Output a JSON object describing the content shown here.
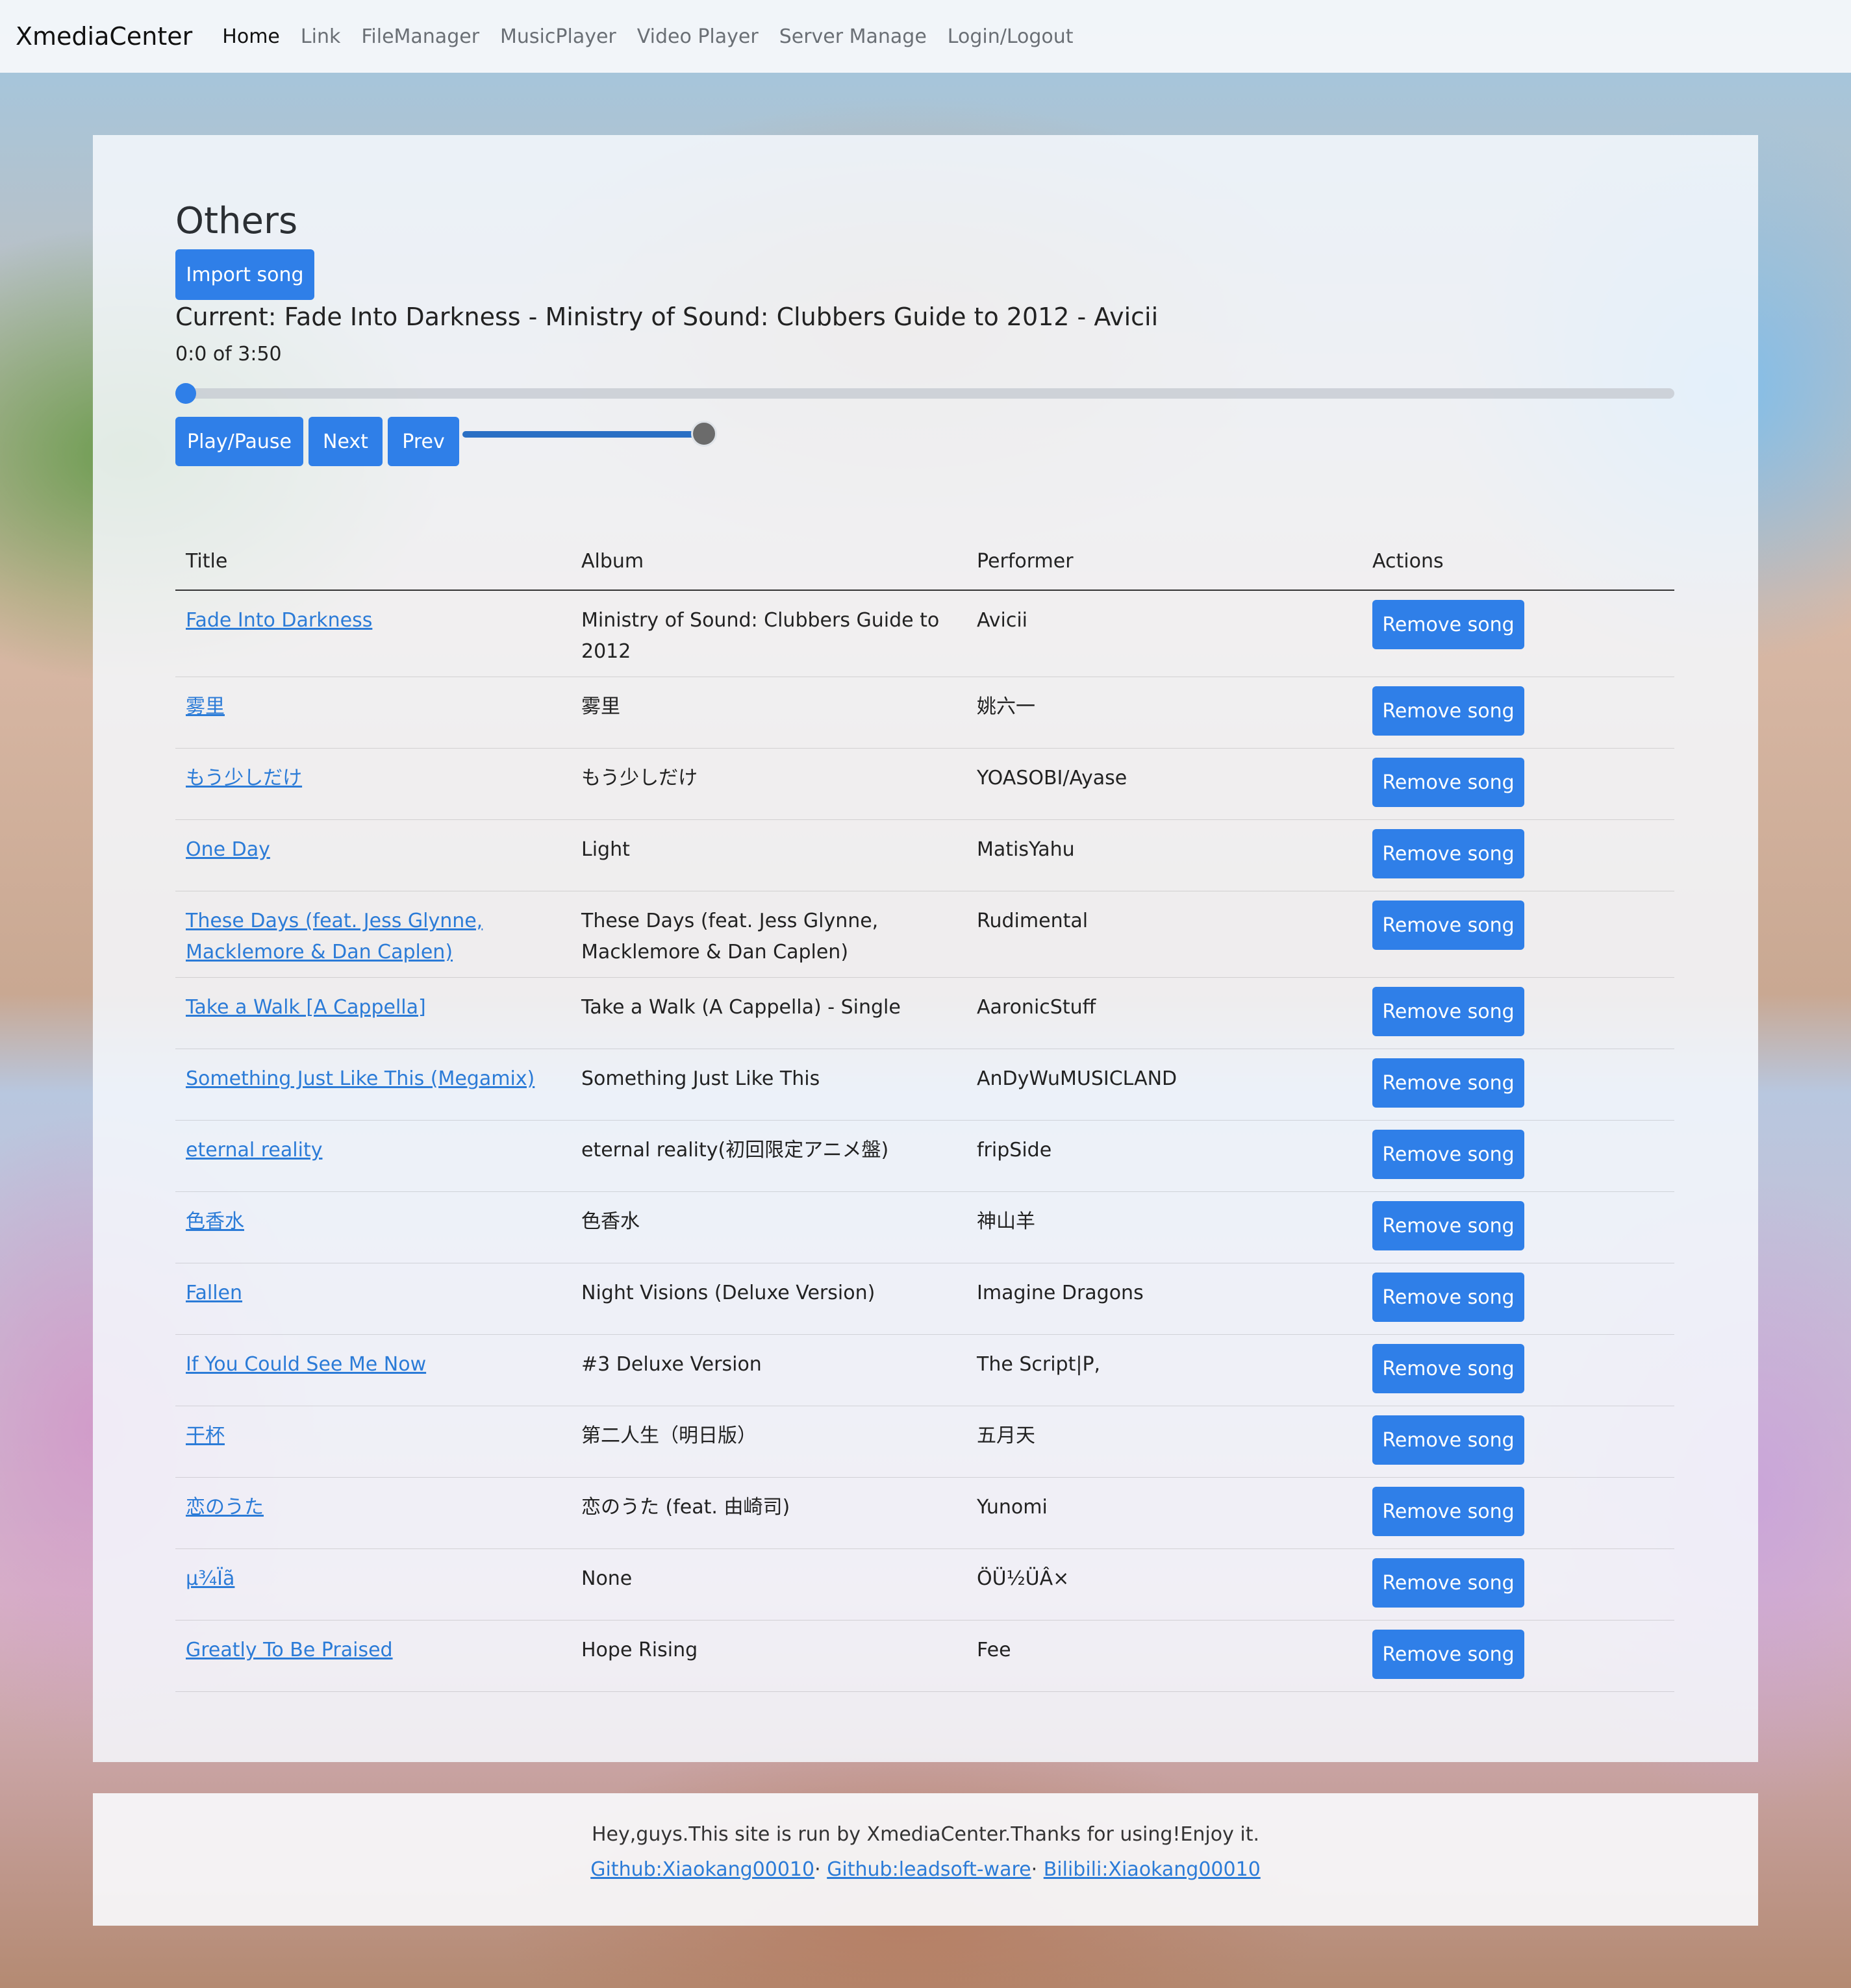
{
  "navbar": {
    "brand": "XmediaCenter",
    "links": [
      "Home",
      "Link",
      "FileManager",
      "MusicPlayer",
      "Video Player",
      "Server Manage",
      "Login/Logout"
    ]
  },
  "player": {
    "section_title": "Others",
    "import_label": "Import song",
    "current_text": "Current: Fade Into Darkness - Ministry of Sound: Clubbers Guide to 2012 - Avicii",
    "time_text": "0:0 of 3:50",
    "progress_fraction": 0.0,
    "volume_fraction": 1.0,
    "play_label": "Play/Pause",
    "next_label": "Next",
    "prev_label": "Prev"
  },
  "table": {
    "headers": [
      "Title",
      "Album",
      "Performer",
      "Actions"
    ],
    "action_label": "Remove song",
    "rows": [
      {
        "title": "Fade Into Darkness",
        "album": "Ministry of Sound: Clubbers Guide to 2012",
        "performer": "Avicii"
      },
      {
        "title": "雾里",
        "album": "雾里",
        "performer": "姚六一"
      },
      {
        "title": "もう少しだけ",
        "album": "もう少しだけ",
        "performer": "YOASOBI/Ayase"
      },
      {
        "title": "One Day",
        "album": "Light",
        "performer": "MatisYahu"
      },
      {
        "title": "These Days (feat. Jess Glynne, Macklemore & Dan Caplen)",
        "album": "These Days (feat. Jess Glynne, Macklemore & Dan Caplen)",
        "performer": "Rudimental"
      },
      {
        "title": "Take a Walk [A Cappella]",
        "album": "Take a Walk (A Cappella) - Single",
        "performer": "AaronicStuff"
      },
      {
        "title": "Something Just Like This (Megamix)",
        "album": "Something Just Like This",
        "performer": "AnDyWuMUSICLAND"
      },
      {
        "title": "eternal reality",
        "album": "eternal reality(初回限定アニメ盤)",
        "performer": "fripSide"
      },
      {
        "title": "色香水",
        "album": "色香水",
        "performer": "神山羊"
      },
      {
        "title": "Fallen",
        "album": "Night Visions (Deluxe Version)",
        "performer": "Imagine Dragons"
      },
      {
        "title": "If You Could See Me Now",
        "album": "#3 Deluxe Version",
        "performer": "The Script|P,"
      },
      {
        "title": "干杯",
        "album": "第二人生（明日版）",
        "performer": "五月天"
      },
      {
        "title": "恋のうた",
        "album": "恋のうた (feat. 由崎司)",
        "performer": "Yunomi"
      },
      {
        "title": "µ¾Ïã",
        "album": "None",
        "performer": "ÖÜ½ÜÂ×"
      },
      {
        "title": "Greatly To Be Praised",
        "album": "Hope Rising",
        "performer": "Fee"
      }
    ]
  },
  "footer": {
    "text": "Hey,guys.This site is run by XmediaCenter.Thanks for using!Enjoy it.",
    "links": [
      "Github:Xiaokang00010",
      "Github:leadsoft-ware",
      "Bilibili:Xiaokang00010"
    ],
    "separator": "·"
  }
}
